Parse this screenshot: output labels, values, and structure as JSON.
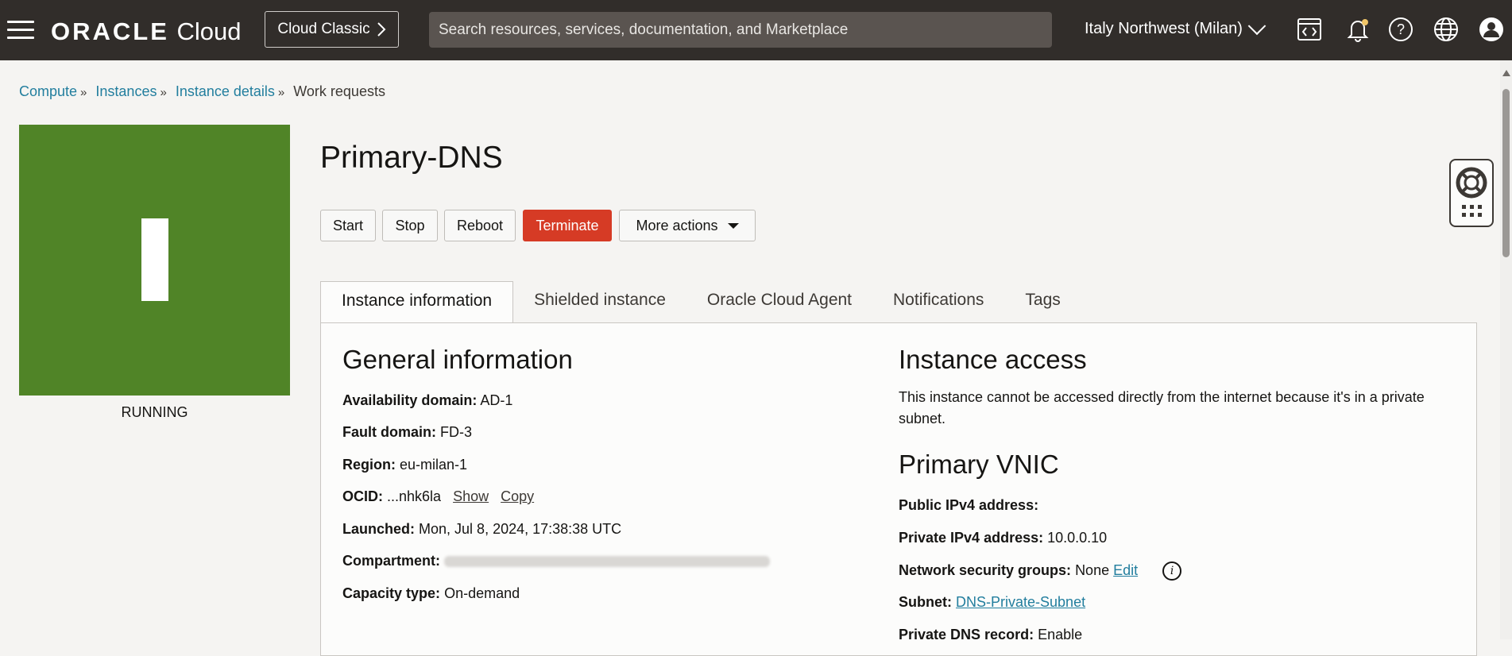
{
  "header": {
    "brand_bold": "ORACLE",
    "brand_light": "Cloud",
    "classic_label": "Cloud Classic",
    "search_placeholder": "Search resources, services, documentation, and Marketplace",
    "region": "Italy Northwest (Milan)"
  },
  "breadcrumb": [
    "Compute",
    "Instances",
    "Instance details",
    "Work requests"
  ],
  "instance": {
    "tile_letter": "I",
    "tile_color": "#508427",
    "status": "RUNNING",
    "name": "Primary-DNS"
  },
  "actions": {
    "start": "Start",
    "stop": "Stop",
    "reboot": "Reboot",
    "terminate": "Terminate",
    "more": "More actions"
  },
  "tabs": [
    "Instance information",
    "Shielded instance",
    "Oracle Cloud Agent",
    "Notifications",
    "Tags"
  ],
  "general": {
    "heading": "General information",
    "availability_label": "Availability domain:",
    "availability_value": "AD-1",
    "fault_label": "Fault domain:",
    "fault_value": "FD-3",
    "region_label": "Region:",
    "region_value": "eu-milan-1",
    "ocid_label": "OCID:",
    "ocid_value": "...nhk6la",
    "ocid_show": "Show",
    "ocid_copy": "Copy",
    "launched_label": "Launched:",
    "launched_value": "Mon, Jul 8, 2024, 17:38:38 UTC",
    "compartment_label": "Compartment:",
    "capacity_label": "Capacity type:",
    "capacity_value": "On-demand"
  },
  "access": {
    "heading": "Instance access",
    "text": "This instance cannot be accessed directly from the internet because it's in a private subnet."
  },
  "vnic": {
    "heading": "Primary VNIC",
    "public_label": "Public IPv4 address:",
    "private_label": "Private IPv4 address:",
    "private_value": "10.0.0.10",
    "nsg_label": "Network security groups:",
    "nsg_value": "None",
    "nsg_edit": "Edit",
    "subnet_label": "Subnet:",
    "subnet_value": "DNS-Private-Subnet",
    "dns_label": "Private DNS record:",
    "dns_value": "Enable"
  },
  "colors": {
    "topbar": "#312d2a",
    "link": "#227e9e",
    "terminate": "#d63b25"
  }
}
